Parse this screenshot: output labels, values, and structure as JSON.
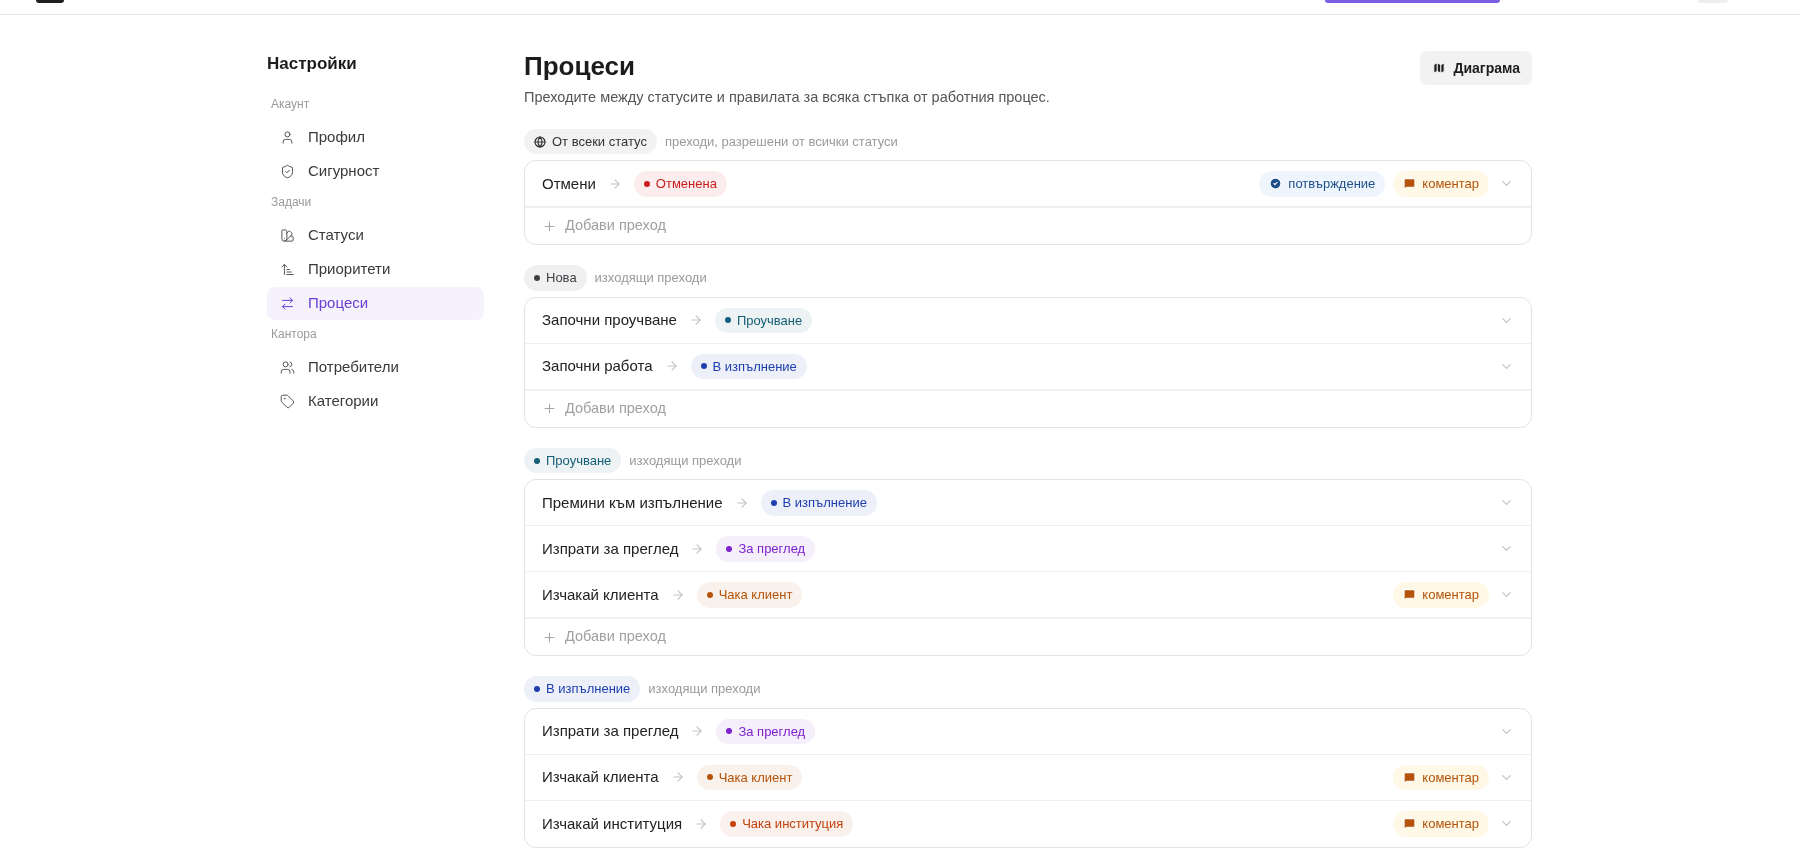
{
  "sidebar": {
    "title": "Настройки",
    "sections": [
      {
        "heading": "Акаунт",
        "items": [
          {
            "label": "Профил",
            "selected": false
          },
          {
            "label": "Сигурност",
            "selected": false
          }
        ]
      },
      {
        "heading": "Задачи",
        "items": [
          {
            "label": "Статуси",
            "selected": false
          },
          {
            "label": "Приоритети",
            "selected": false
          },
          {
            "label": "Процеси",
            "selected": true
          }
        ]
      },
      {
        "heading": "Кантора",
        "items": [
          {
            "label": "Потребители",
            "selected": false
          },
          {
            "label": "Категории",
            "selected": false
          }
        ]
      }
    ]
  },
  "page": {
    "title": "Процеси",
    "subtitle": "Преходите между статусите и правилата за всяка стъпка от работния процес.",
    "diagram_button": "Диаграма"
  },
  "groups": [
    {
      "source": {
        "kind": "all",
        "label": "От всеки статус"
      },
      "note": "преходи, разрешени от всички статуси",
      "add_label": "Добави преход",
      "transitions": [
        {
          "name": "Отмени",
          "target": {
            "label": "Отменена",
            "color": "#c81e1e"
          },
          "tags": [
            {
              "kind": "confirmation",
              "label": "потвърждение"
            },
            {
              "kind": "comment",
              "label": "коментар"
            }
          ]
        }
      ]
    },
    {
      "source": {
        "kind": "status",
        "label": "Нова",
        "color": "#3f3f46"
      },
      "note": "изходящи преходи",
      "add_label": "Добави преход",
      "transitions": [
        {
          "name": "Започни проучване",
          "target": {
            "label": "Проучване",
            "color": "#155e75"
          }
        },
        {
          "name": "Започни работа",
          "target": {
            "label": "В изпълнение",
            "color": "#1e40af"
          }
        }
      ]
    },
    {
      "source": {
        "kind": "status",
        "label": "Проучване",
        "color": "#155e75"
      },
      "note": "изходящи преходи",
      "add_label": "Добави преход",
      "transitions": [
        {
          "name": "Премини към изпълнение",
          "target": {
            "label": "В изпълнение",
            "color": "#1e40af"
          }
        },
        {
          "name": "Изпрати за преглед",
          "target": {
            "label": "За преглед",
            "color": "#7e22ce"
          }
        },
        {
          "name": "Изчакай клиента",
          "target": {
            "label": "Чака клиент",
            "color": "#b45309"
          },
          "tags": [
            {
              "kind": "comment",
              "label": "коментар"
            }
          ]
        }
      ]
    },
    {
      "source": {
        "kind": "status",
        "label": "В изпълнение",
        "color": "#1e40af"
      },
      "note": "изходящи преходи",
      "transitions": [
        {
          "name": "Изпрати за преглед",
          "target": {
            "label": "За преглед",
            "color": "#7e22ce"
          }
        },
        {
          "name": "Изчакай клиента",
          "target": {
            "label": "Чака клиент",
            "color": "#b45309"
          },
          "tags": [
            {
              "kind": "comment",
              "label": "коментар"
            }
          ]
        },
        {
          "name": "Изчакай институция",
          "target": {
            "label": "Чака институция",
            "color": "#c2410c"
          },
          "tags": [
            {
              "kind": "comment",
              "label": "коментар"
            }
          ]
        }
      ]
    }
  ]
}
